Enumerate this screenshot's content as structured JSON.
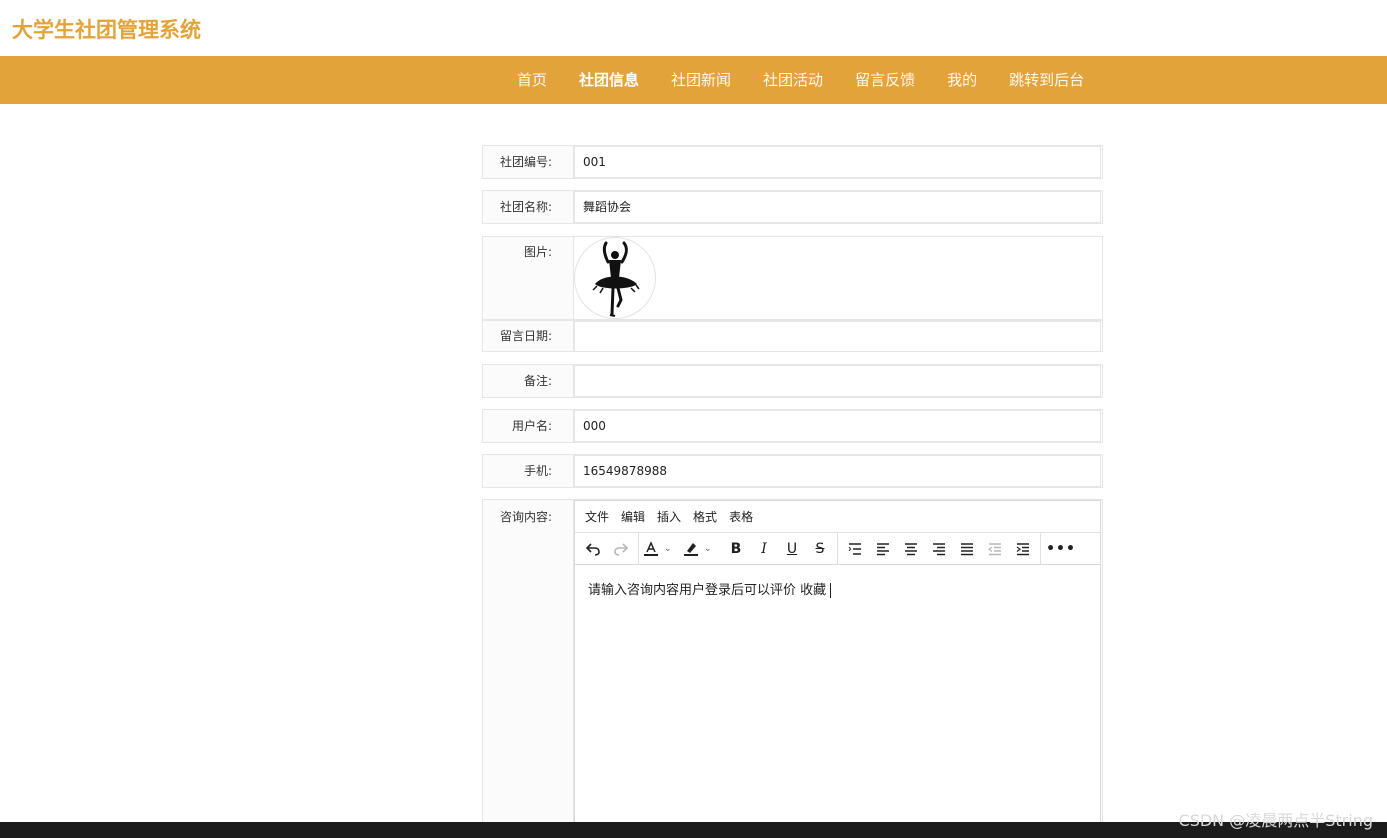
{
  "app": {
    "title": "大学生社团管理系统"
  },
  "nav": {
    "items": [
      {
        "label": "首页",
        "active": false
      },
      {
        "label": "社团信息",
        "active": true
      },
      {
        "label": "社团新闻",
        "active": false
      },
      {
        "label": "社团活动",
        "active": false
      },
      {
        "label": "留言反馈",
        "active": false
      },
      {
        "label": "我的",
        "active": false
      },
      {
        "label": "跳转到后台",
        "active": false
      }
    ]
  },
  "form": {
    "club_no": {
      "label": "社团编号:",
      "value": "001"
    },
    "club_name": {
      "label": "社团名称:",
      "value": "舞蹈协会"
    },
    "image": {
      "label": "图片:",
      "icon": "ballet-dancer-image"
    },
    "message_date": {
      "label": "留言日期:",
      "value": ""
    },
    "remark": {
      "label": "备注:",
      "value": ""
    },
    "username": {
      "label": "用户名:",
      "value": "000"
    },
    "phone": {
      "label": "手机:",
      "value": "16549878988"
    },
    "consult": {
      "label": "咨询内容:",
      "menubar": [
        "文件",
        "编辑",
        "插入",
        "格式",
        "表格"
      ],
      "content": "请输入咨询内容用户登录后可以评价  收藏"
    }
  },
  "colors": {
    "brand": "#e2a43a",
    "nav_text": "#ffffff"
  },
  "watermark": "CSDN @凌晨两点半String"
}
